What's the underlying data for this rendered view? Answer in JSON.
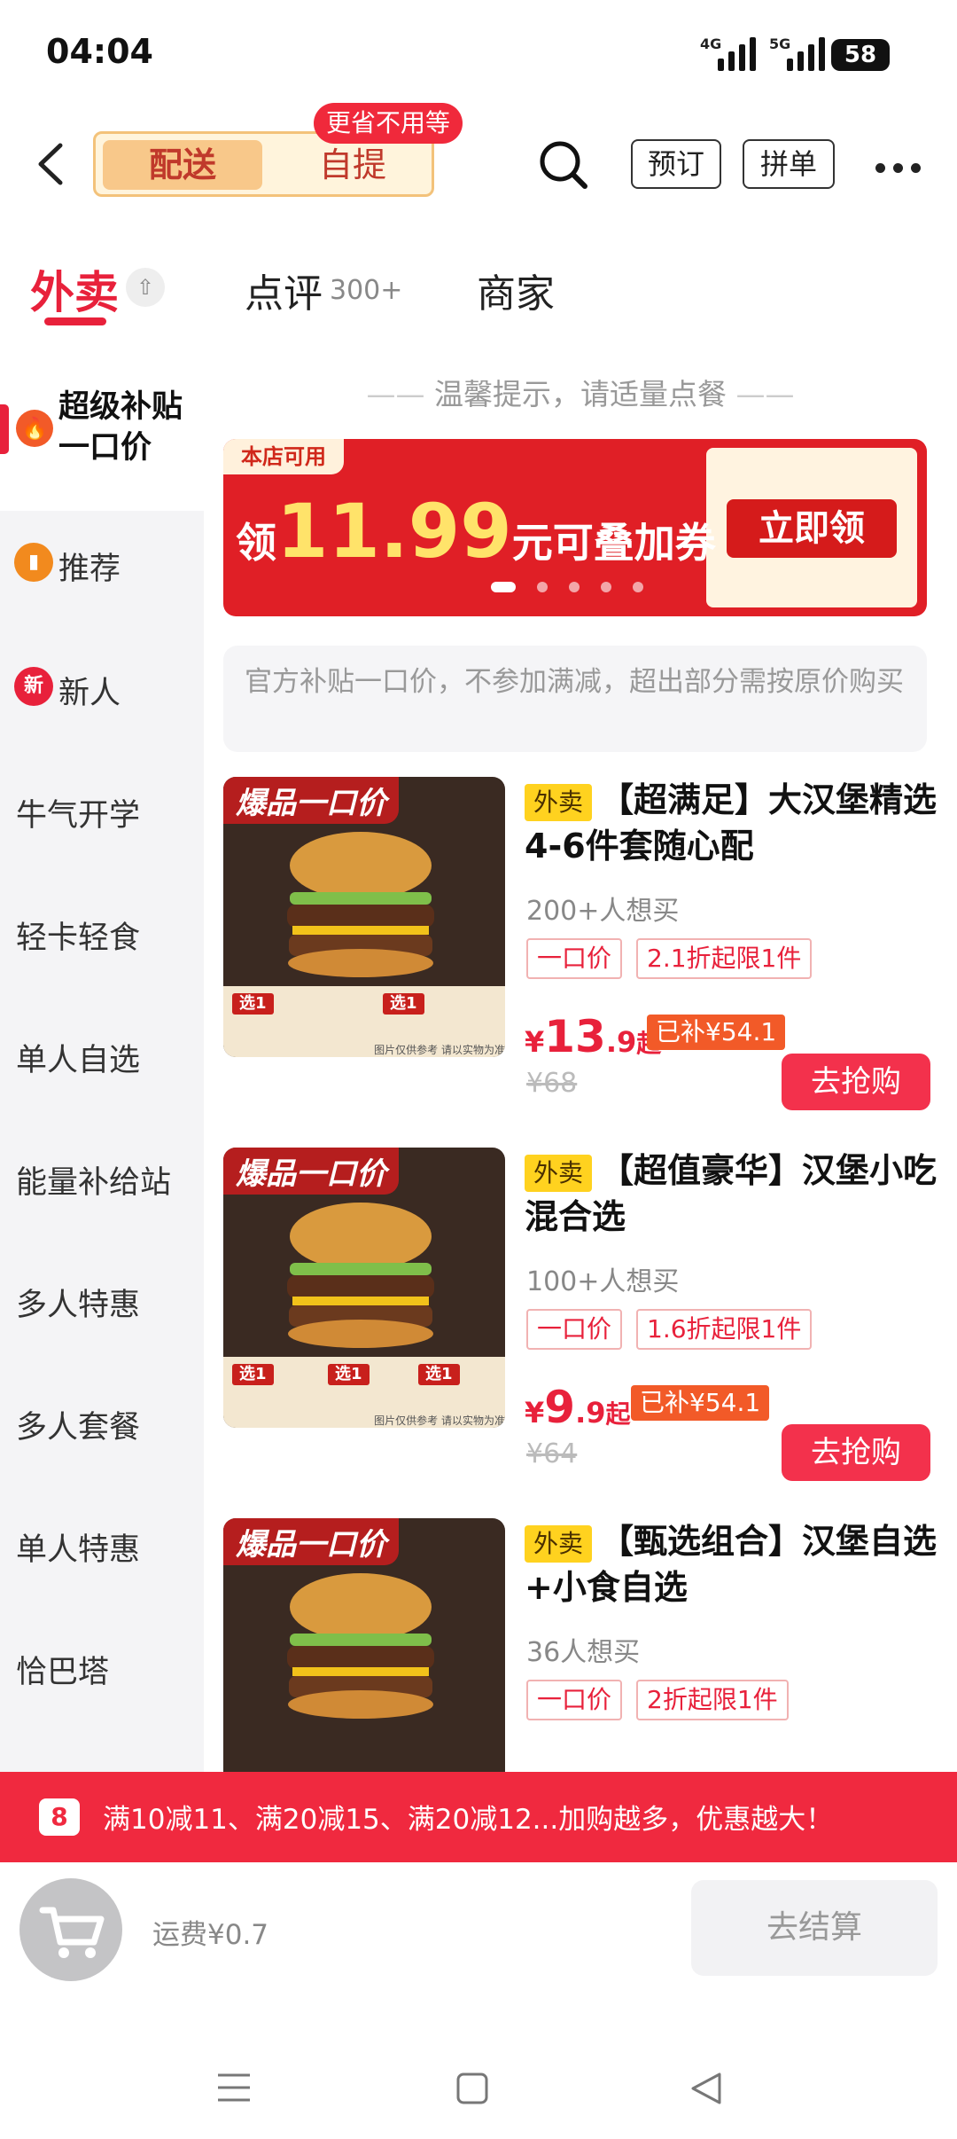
{
  "status": {
    "time": "04:04",
    "net1": "4G",
    "net2": "5G",
    "battery": "58"
  },
  "header": {
    "delivery": "配送",
    "pickup": "自提",
    "bubble": "更省不用等",
    "reserve": "预订",
    "group": "拼单"
  },
  "tabs": {
    "takeout": "外卖",
    "review": "点评",
    "review_count": "300+",
    "merchant": "商家"
  },
  "sidebar": {
    "active": "超级补贴一口价",
    "items": [
      {
        "label": "推荐",
        "icon": "bookmark-icon"
      },
      {
        "label": "新人",
        "badge": "新"
      },
      {
        "label": "牛气开学"
      },
      {
        "label": "轻卡轻食"
      },
      {
        "label": "单人自选"
      },
      {
        "label": "能量补给站"
      },
      {
        "label": "多人特惠"
      },
      {
        "label": "多人套餐"
      },
      {
        "label": "单人特惠"
      },
      {
        "label": "恰巴塔"
      }
    ]
  },
  "tip": "温馨提示，请适量点餐",
  "banner": {
    "tag": "本店可用",
    "pre": "领",
    "amount": "11.99",
    "post": "元可叠加券",
    "button": "立即领"
  },
  "notice": "官方补贴一口价，不参加满减，超出部分需按原价购买",
  "products": [
    {
      "img_label": "爆品一口价",
      "tag": "外卖",
      "title": "【超满足】大汉堡精选4-6件套随心配",
      "want": "200+人想买",
      "t1": "一口价",
      "t2": "2.1折起限1件",
      "price_int": "13",
      "price_dec": ".9",
      "price_suffix": "起",
      "subsidy": "已补¥54.1",
      "orig": "¥68",
      "buy": "去抢购"
    },
    {
      "img_label": "爆品一口价",
      "tag": "外卖",
      "title": "【超值豪华】汉堡小吃混合选",
      "want": "100+人想买",
      "t1": "一口价",
      "t2": "1.6折起限1件",
      "price_int": "9",
      "price_dec": ".9",
      "price_suffix": "起",
      "subsidy": "已补¥54.1",
      "orig": "¥64",
      "buy": "去抢购"
    },
    {
      "img_label": "爆品一口价",
      "tag": "外卖",
      "title": "【甄选组合】汉堡自选+小食自选",
      "want": "36人想买",
      "t1": "一口价",
      "t2": "2折起限1件"
    }
  ],
  "img_strip": {
    "badge": "选1",
    "disclaimer": "图片仅供参考 请以实物为准"
  },
  "currency": "¥",
  "promo": {
    "icon": "8",
    "text": "满10减11、满20减15、满20减12...加购越多，优惠越大！"
  },
  "bottom": {
    "fee": "运费¥0.7",
    "checkout": "去结算"
  },
  "colors": {
    "accent": "#e8213b",
    "promo": "#f0293f",
    "banner": "#e01f26"
  }
}
